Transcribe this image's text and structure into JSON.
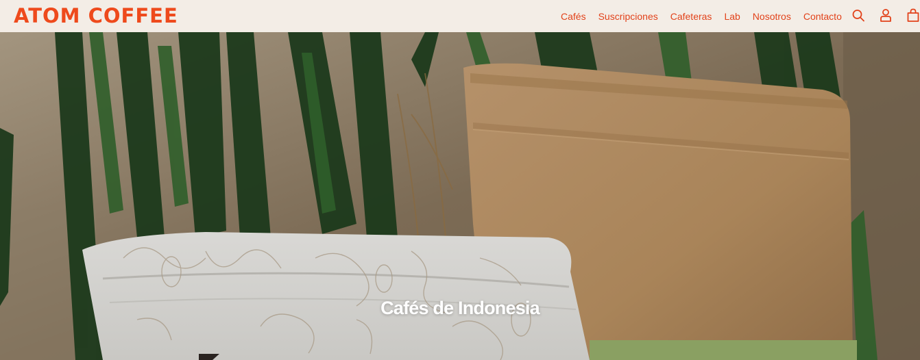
{
  "brand": {
    "logo_text": "ATOM COFFEE",
    "accent_color": "#ee4a1c"
  },
  "nav": {
    "items": [
      {
        "label": "Cafés"
      },
      {
        "label": "Suscripciones"
      },
      {
        "label": "Cafeteras"
      },
      {
        "label": "Lab"
      },
      {
        "label": "Nosotros"
      },
      {
        "label": "Contacto"
      }
    ]
  },
  "header_icons": [
    "search-icon",
    "account-icon",
    "cart-icon"
  ],
  "hero": {
    "title": "Cafés de Indonesia",
    "image": "coffee-bags-with-plant-leaves"
  }
}
